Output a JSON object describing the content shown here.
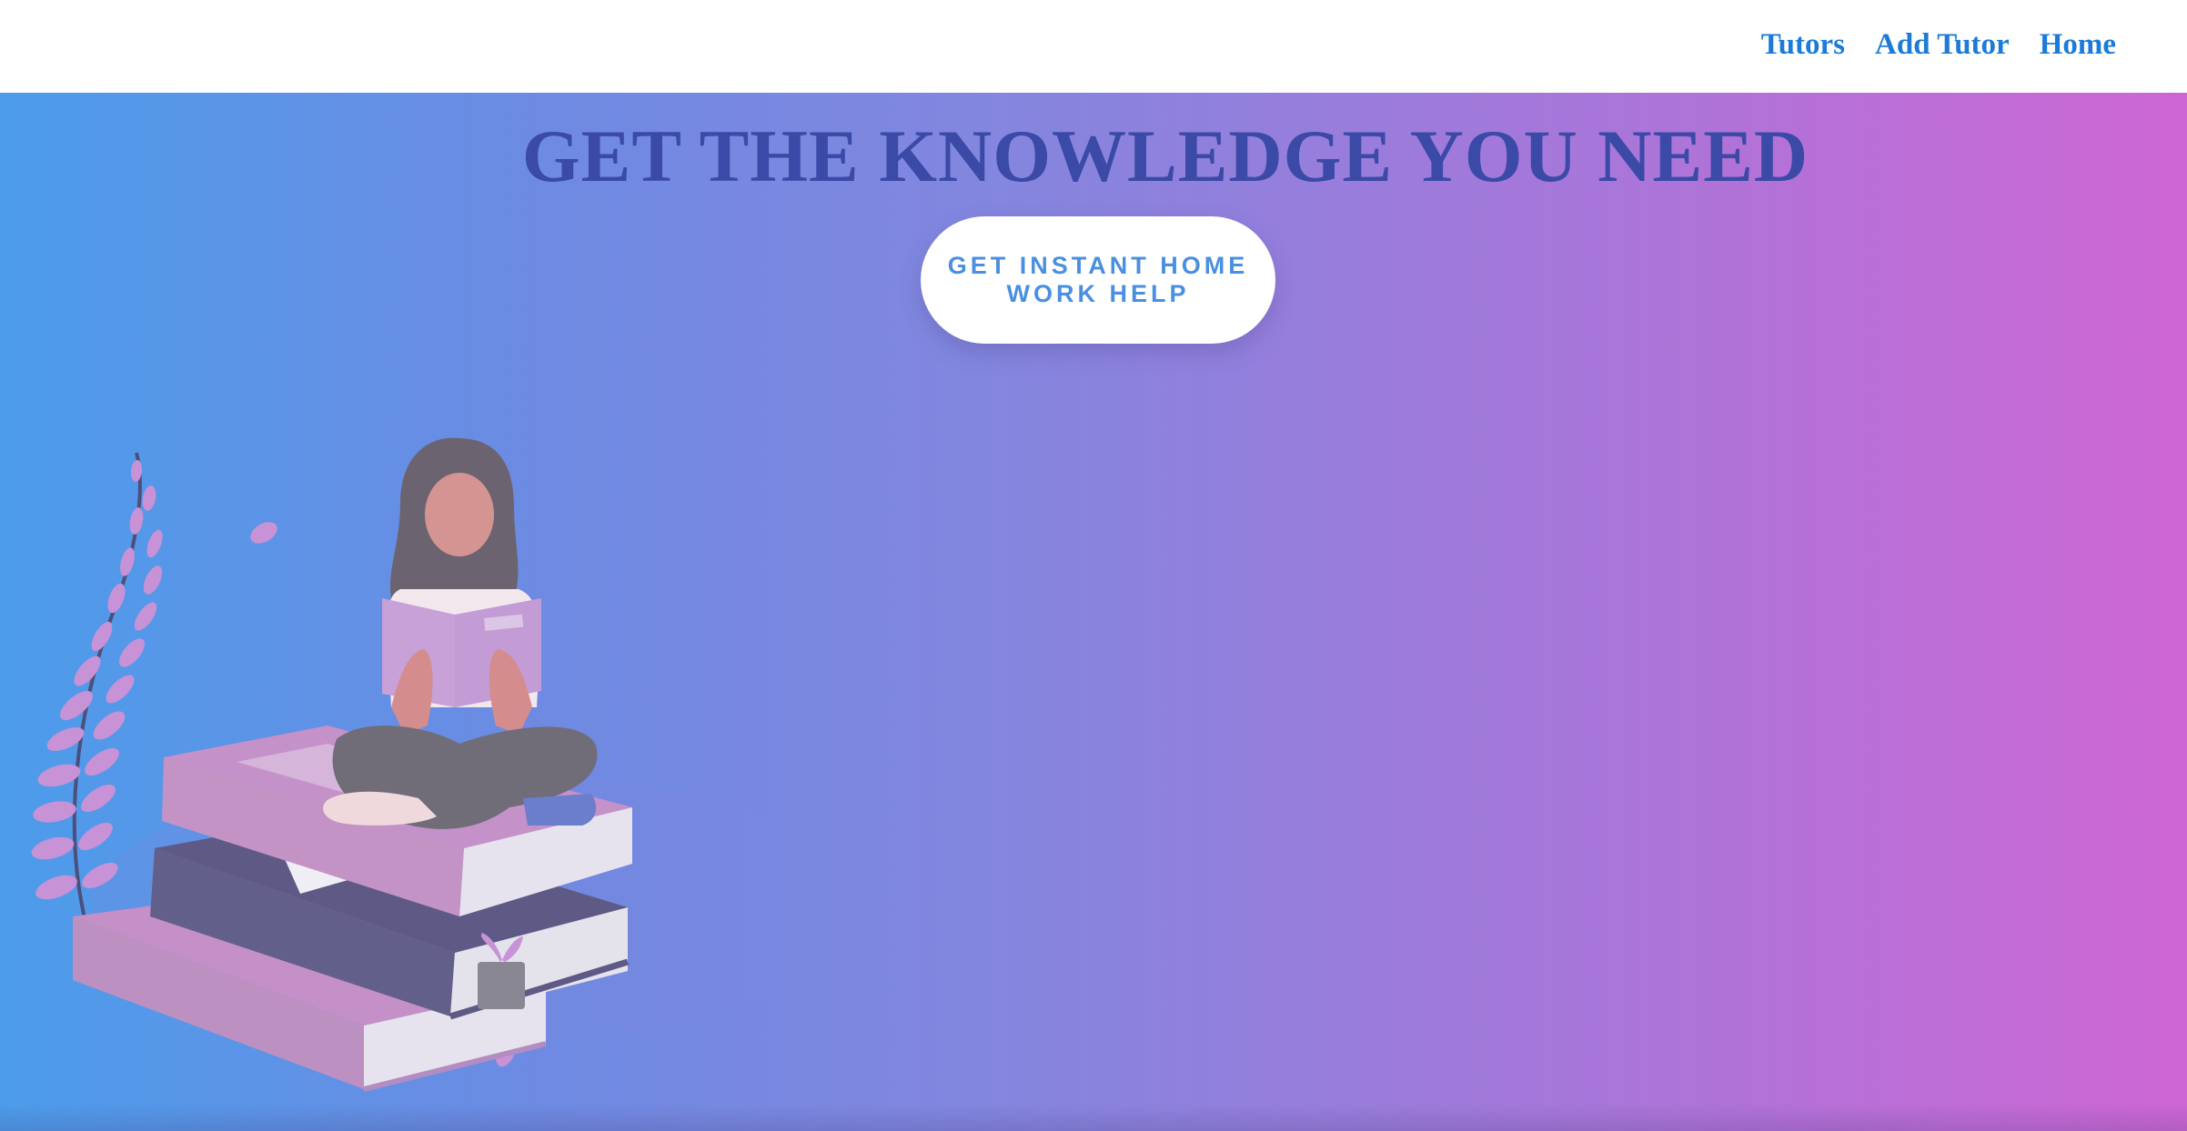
{
  "nav": {
    "links": [
      "Tutors",
      "Add Tutor",
      "Home"
    ]
  },
  "hero": {
    "title": "GET THE KNOWLEDGE YOU NEED",
    "cta_label": "GET INSTANT HOME WORK HELP",
    "illustration": "woman-reading-on-books-illustration"
  },
  "colors": {
    "nav_link": "#1b7bd6",
    "title": "#3a4aa6",
    "cta_text": "#4a8fe0",
    "gradient_start": "#4c9ceb",
    "gradient_end": "#cd66d4"
  }
}
